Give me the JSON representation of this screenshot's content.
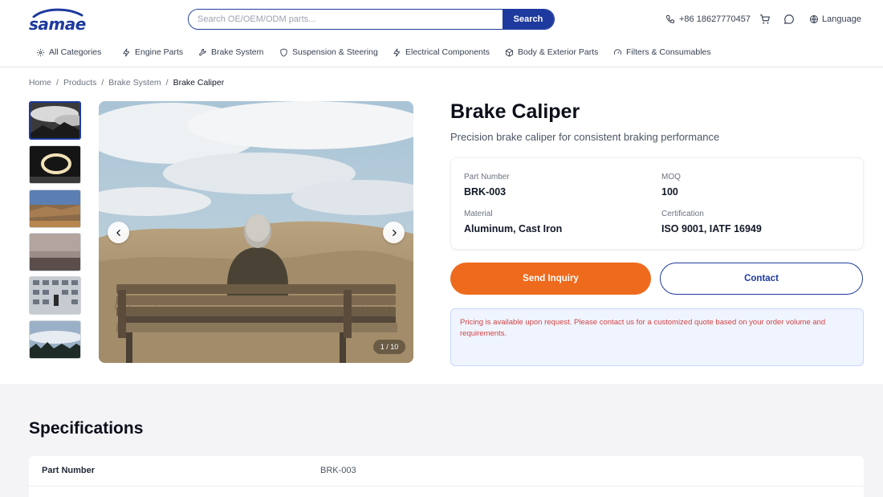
{
  "brand": {
    "logo_text": "samae",
    "primary": "#1e3a9e",
    "accent": "#ee6a1c"
  },
  "header": {
    "search_placeholder": "Search OE/OEM/ODM parts...",
    "search_button": "Search",
    "phone": "+86 18627770457",
    "language_label": "Language",
    "icons": [
      "phone-icon",
      "cart-icon",
      "chat-icon",
      "globe-icon"
    ]
  },
  "nav": {
    "items": [
      {
        "label": "All Categories",
        "icon": "gear-icon"
      },
      {
        "label": "Engine Parts",
        "icon": "bolt-icon"
      },
      {
        "label": "Brake System",
        "icon": "wrench-icon"
      },
      {
        "label": "Suspension & Steering",
        "icon": "shield-icon"
      },
      {
        "label": "Electrical Components",
        "icon": "bolt-icon"
      },
      {
        "label": "Body & Exterior Parts",
        "icon": "box-icon"
      },
      {
        "label": "Filters & Consumables",
        "icon": "gauge-icon"
      }
    ]
  },
  "breadcrumb": {
    "items": [
      "Home",
      "Products",
      "Brake System"
    ],
    "current": "Brake Caliper"
  },
  "gallery": {
    "counter": "1 / 10",
    "thumbnails": [
      "clouds-mountains",
      "light-ring",
      "desert-landscape",
      "dusk-horizon",
      "building-figure",
      "misty-forest"
    ]
  },
  "product": {
    "title": "Brake Caliper",
    "subtitle": "Precision brake caliper for consistent braking performance",
    "info": {
      "part_number_label": "Part Number",
      "part_number": "BRK-003",
      "moq_label": "MOQ",
      "moq": "100",
      "material_label": "Material",
      "material": "Aluminum, Cast Iron",
      "certification_label": "Certification",
      "certification": "ISO 9001, IATF 16949"
    },
    "inquiry_button": "Send Inquiry",
    "contact_button": "Contact",
    "pricing_note": "Pricing is available upon request. Please contact us for a customized quote based on your order volume and requirements."
  },
  "specs": {
    "title": "Specifications",
    "rows": [
      {
        "key": "Part Number",
        "value": "BRK-003"
      }
    ]
  }
}
